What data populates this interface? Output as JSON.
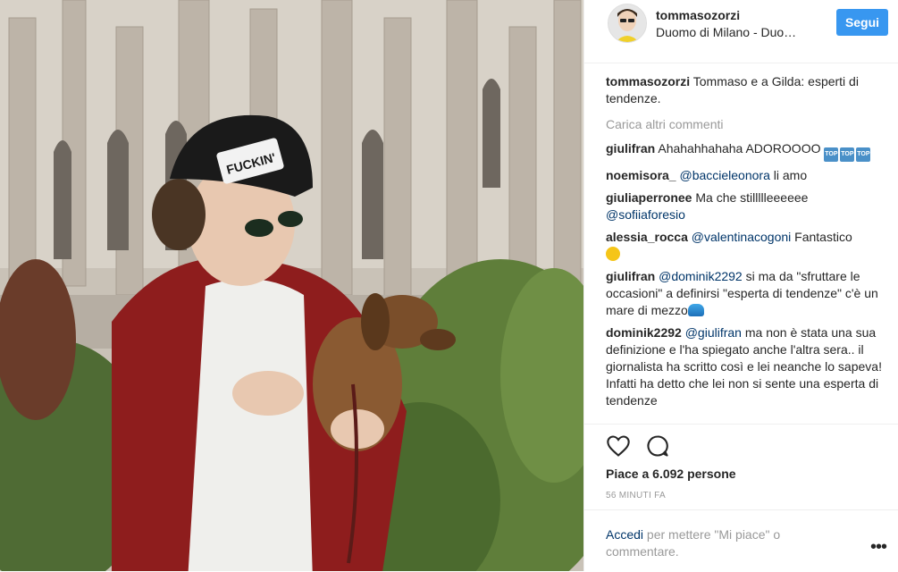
{
  "header": {
    "username": "tommasozorzi",
    "location": "Duomo di Milano - Duo…",
    "follow_label": "Segui"
  },
  "caption": {
    "username": "tommasozorzi",
    "text": "Tommaso e a Gilda: esperti di tendenze."
  },
  "load_more_label": "Carica altri commenti",
  "comments": [
    {
      "username": "giulifran",
      "text": "Ahahahhahaha ADOROOOO",
      "emojis": [
        "TOP",
        "TOP",
        "TOP"
      ]
    },
    {
      "username": "noemisora_",
      "mention": "@baccieleonora",
      "text": " li amo"
    },
    {
      "username": "giuliaperronee",
      "text": "Ma che stillllleeeeee ",
      "mention": "@sofiiaforesio"
    },
    {
      "username": "alessia_rocca",
      "mention": "@valentinacogoni",
      "text": " Fantastico"
    },
    {
      "username": "giulifran",
      "mention": "@dominik2292",
      "text": " si ma da \"sfruttare le occasioni\" a definirsi \"esperta di tendenze\" c'è un mare di mezzo"
    },
    {
      "username": "dominik2292",
      "mention": "@giulifran",
      "text": " ma non è stata una sua definizione e l'ha spiegato anche l'altra sera.. il giornalista ha scritto così e lei neanche lo sapeva! Infatti ha detto che lei non si sente una esperta di tendenze"
    }
  ],
  "likes_text": "Piace a 6.092 persone",
  "timestamp": "56 MINUTI FA",
  "footer": {
    "login_label": "Accedi",
    "rest_text": " per mettere \"Mi piace\" o commentare.",
    "more_label": "•••"
  },
  "icons": {
    "like": "heart-icon",
    "comment": "comment-icon",
    "more": "more-options-icon"
  },
  "colors": {
    "accent": "#3897f0",
    "link": "#003569",
    "muted": "#999999",
    "text": "#262626"
  }
}
